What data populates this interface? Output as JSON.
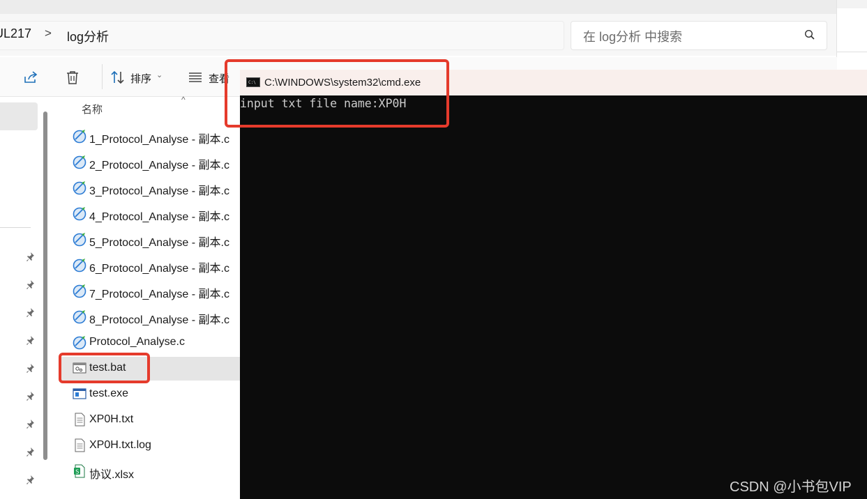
{
  "address_bar": {
    "segments": [
      "UL217",
      "log分析"
    ],
    "separator": ">"
  },
  "search": {
    "placeholder": "在 log分析 中搜索"
  },
  "toolbar": {
    "share_icon": "share-icon",
    "delete_icon": "trash-icon",
    "sort_label": "排序",
    "view_label": "查看"
  },
  "file_list": {
    "column_header": "名称",
    "files": [
      {
        "name": "1_Protocol_Analyse - 副本.c",
        "icon": "c-source-file-icon"
      },
      {
        "name": "2_Protocol_Analyse - 副本.c",
        "icon": "c-source-file-icon"
      },
      {
        "name": "3_Protocol_Analyse - 副本.c",
        "icon": "c-source-file-icon"
      },
      {
        "name": "4_Protocol_Analyse - 副本.c",
        "icon": "c-source-file-icon"
      },
      {
        "name": "5_Protocol_Analyse - 副本.c",
        "icon": "c-source-file-icon"
      },
      {
        "name": "6_Protocol_Analyse - 副本.c",
        "icon": "c-source-file-icon"
      },
      {
        "name": "7_Protocol_Analyse - 副本.c",
        "icon": "c-source-file-icon"
      },
      {
        "name": "8_Protocol_Analyse - 副本.c",
        "icon": "c-source-file-icon"
      },
      {
        "name": "Protocol_Analyse.c",
        "icon": "c-source-file-icon"
      },
      {
        "name": "test.bat",
        "icon": "batch-file-icon",
        "selected": true
      },
      {
        "name": "test.exe",
        "icon": "exe-file-icon"
      },
      {
        "name": "XP0H.txt",
        "icon": "text-file-icon"
      },
      {
        "name": "XP0H.txt.log",
        "icon": "text-file-icon"
      },
      {
        "name": "协议.xlsx",
        "icon": "excel-file-icon"
      }
    ]
  },
  "cmd_window": {
    "title": "C:\\WINDOWS\\system32\\cmd.exe",
    "output": "input txt file name:XP0H"
  },
  "highlight_color": "#e53b2c",
  "watermark": "CSDN @小书包VIP"
}
